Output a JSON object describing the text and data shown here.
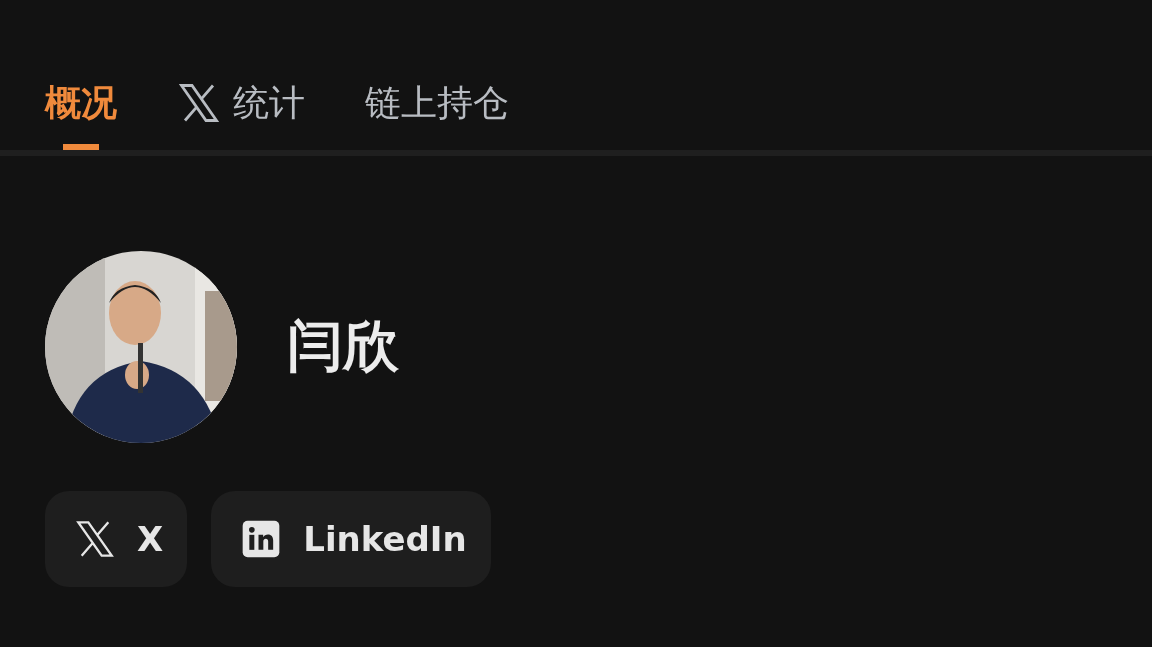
{
  "tabs": [
    {
      "label": "概况",
      "kind": "text",
      "selected": true
    },
    {
      "label": "统计",
      "kind": "x",
      "selected": false
    },
    {
      "label": "链上持仓",
      "kind": "text",
      "selected": false
    }
  ],
  "profile": {
    "name": "闫欣"
  },
  "links": [
    {
      "label": "X",
      "kind": "x"
    },
    {
      "label": "LinkedIn",
      "kind": "linkedin"
    }
  ]
}
